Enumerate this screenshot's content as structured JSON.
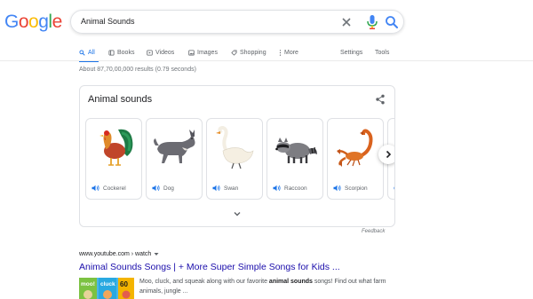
{
  "logo": {
    "letters": [
      "G",
      "o",
      "o",
      "g",
      "l",
      "e"
    ],
    "colors": [
      "#4285F4",
      "#EA4335",
      "#FBBC05",
      "#4285F4",
      "#34A853",
      "#EA4335"
    ]
  },
  "search": {
    "query": "Animal Sounds"
  },
  "tabs": [
    {
      "label": "All",
      "icon": "search-icon",
      "active": true
    },
    {
      "label": "Books",
      "icon": "tag-icon"
    },
    {
      "label": "Videos",
      "icon": "video-icon"
    },
    {
      "label": "Images",
      "icon": "image-icon"
    },
    {
      "label": "Shopping",
      "icon": "shopping-tag-icon"
    },
    {
      "label": "More",
      "icon": "more-vert-icon"
    }
  ],
  "tools": {
    "settings": "Settings",
    "tools": "Tools"
  },
  "stats": "About 87,70,00,000 results (0.79 seconds)",
  "card": {
    "title": "Animal sounds",
    "animals": [
      {
        "label": "Cockerel"
      },
      {
        "label": "Dog"
      },
      {
        "label": "Swan"
      },
      {
        "label": "Raccoon"
      },
      {
        "label": "Scorpion"
      }
    ],
    "feedback": "Feedback"
  },
  "result": {
    "cite": "www.youtube.com › watch",
    "title": "Animal Sounds Songs | + More Super Simple Songs for Kids ...",
    "snippet_pre": "Moo, cluck, and squeak along with our favorite ",
    "snippet_bold": "animal sounds",
    "snippet_post": " songs! Find out what farm animals, jungle ...",
    "thumb": {
      "badge1": "moo!",
      "badge2": "cluck",
      "badge3": "60"
    }
  },
  "colors": {
    "accent": "#1a73e8",
    "link": "#1a0dab"
  }
}
